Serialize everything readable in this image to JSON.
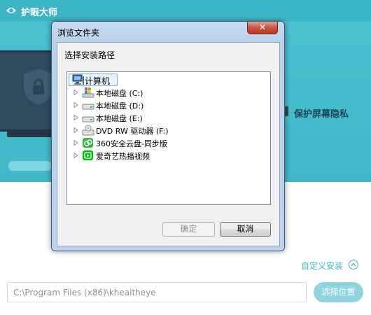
{
  "app": {
    "title": "护眼大师",
    "tagline": "保护屏幕隐私"
  },
  "install": {
    "custom_label": "自定义安装",
    "path_value": "C:\\Program Files (x86)\\khealtheye",
    "choose_label": "选择位置"
  },
  "dialog": {
    "title": "浏览文件夹",
    "close_glyph": "✕",
    "prompt": "选择安装路径",
    "tree": {
      "root": "计算机",
      "items": [
        {
          "label": "本地磁盘 (C:)",
          "icon": "windows-drive-icon"
        },
        {
          "label": "本地磁盘 (D:)",
          "icon": "hard-drive-icon"
        },
        {
          "label": "本地磁盘 (E:)",
          "icon": "hard-drive-icon"
        },
        {
          "label": "DVD RW 驱动器 (F:)",
          "icon": "dvd-drive-icon"
        },
        {
          "label": "360安全云盘-同步版",
          "icon": "cloud-drive-icon"
        },
        {
          "label": "爱奇艺热播视频",
          "icon": "iqiyi-icon"
        }
      ]
    },
    "ok_label": "确定",
    "cancel_label": "取消"
  },
  "colors": {
    "accent": "#3cb6c6",
    "dark": "#2e4a5d",
    "dialog_frame": "#b9d1ea",
    "close": "#c9543f"
  }
}
